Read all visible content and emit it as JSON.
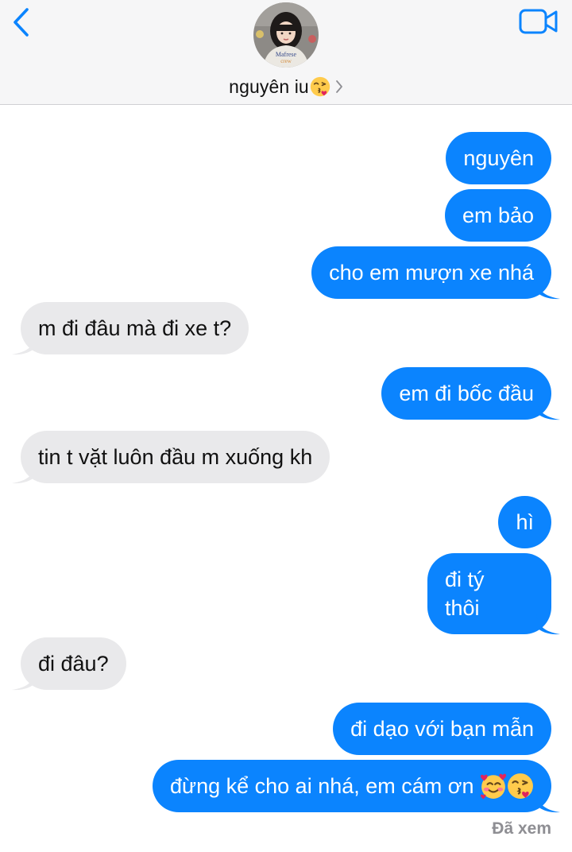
{
  "header": {
    "contact_name": "nguyên iu",
    "contact_emoji": "face-blowing-a-kiss",
    "back_icon": "chevron-left-icon",
    "video_icon": "video-camera-icon",
    "accent_color": "#0b84fe"
  },
  "messages": [
    {
      "from": "me",
      "text": "nguyên"
    },
    {
      "from": "me",
      "text": "em bảo"
    },
    {
      "from": "me",
      "text": "cho em mượn xe nhá"
    },
    {
      "from": "them",
      "text": "m đi đâu mà đi xe t?"
    },
    {
      "from": "me",
      "text": "em đi bốc đầu"
    },
    {
      "from": "them",
      "text": "tin t vặt luôn đầu m xuống kh"
    },
    {
      "from": "me",
      "text": "hì"
    },
    {
      "from": "me",
      "text": "đi tý"
    },
    {
      "from": "me",
      "text": "thôi"
    },
    {
      "from": "them",
      "text": "đi đâu?"
    },
    {
      "from": "me",
      "text": "đi dạo với bạn mẫn"
    },
    {
      "from": "me",
      "text": "đừng kể cho ai nhá, em cám ơn",
      "emojis": [
        "smiling-face-with-hearts",
        "face-blowing-a-kiss"
      ]
    }
  ],
  "read_receipt": "Đã xem",
  "colors": {
    "outgoing_bubble": "#0b84fe",
    "incoming_bubble": "#e9e9eb",
    "header_bg": "#f6f6f7"
  }
}
